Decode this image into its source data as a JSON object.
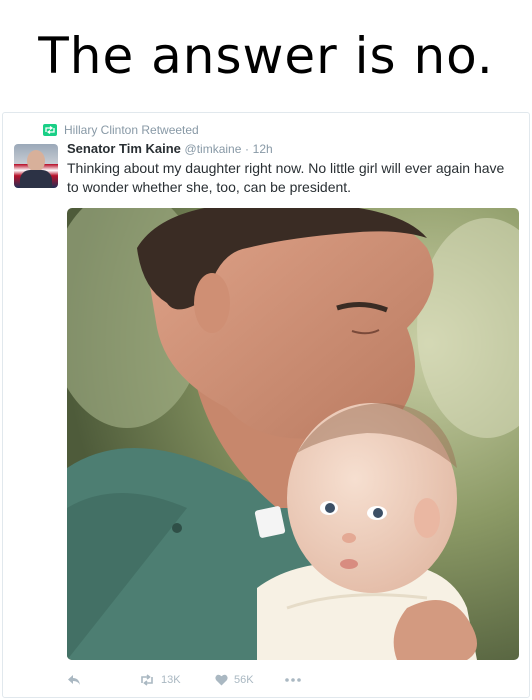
{
  "caption": "The answer is no.",
  "tweet": {
    "retweet_context": "Hillary Clinton Retweeted",
    "author_name": "Senator Tim Kaine",
    "author_handle": "@timkaine",
    "separator": "·",
    "timestamp": "12h",
    "text": "Thinking about my daughter right now. No little girl will ever again have to wonder whether she, too, can be president.",
    "photo_label": "",
    "actions": {
      "retweet_count": "13K",
      "like_count": "56K"
    }
  },
  "colors": {
    "retweet_green": "#19cf86",
    "muted": "#8899a6",
    "action_gray": "#aab8c2",
    "text": "#292f33"
  },
  "icons": [
    "retweet-icon",
    "reply-icon",
    "like-icon",
    "more-icon"
  ]
}
